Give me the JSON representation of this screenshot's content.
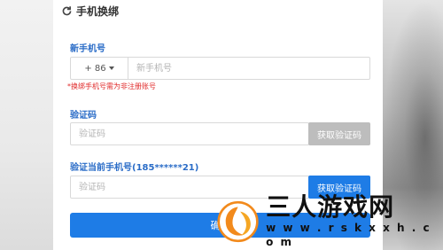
{
  "header": {
    "title": "手机换绑",
    "icon": "refresh-icon"
  },
  "new_phone": {
    "label": "新手机号",
    "country_code": "+ 86",
    "placeholder": "新手机号",
    "hint": "*换绑手机号需为非注册账号"
  },
  "verify_new": {
    "label": "验证码",
    "placeholder": "验证码",
    "button_label": "获取验证码"
  },
  "verify_current": {
    "label": "验证当前手机号(185******21)",
    "placeholder": "验证码",
    "button_label": "获取验证码"
  },
  "confirm": {
    "label": "确认"
  },
  "watermark": {
    "title": "三人游戏网",
    "url": "w w w . r s k x x h . c o m"
  },
  "colors": {
    "accent": "#1e7ce6",
    "label": "#2a6cc7",
    "warning": "#e02a2a",
    "disabled": "#bdbdbd"
  }
}
